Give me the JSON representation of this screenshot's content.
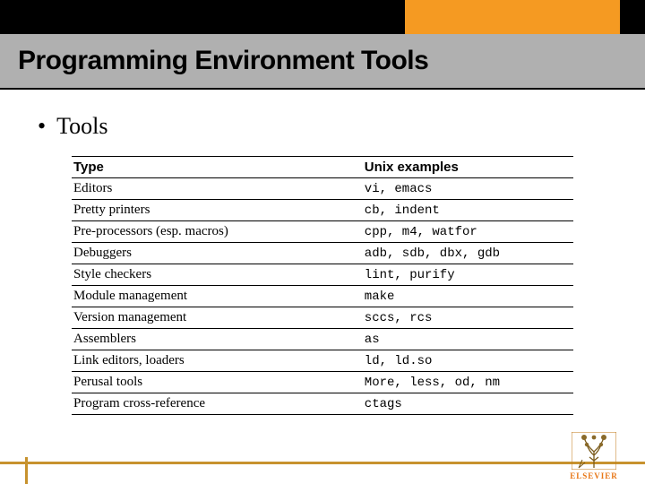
{
  "slide": {
    "title": "Programming Environment Tools",
    "bullet": "Tools"
  },
  "table": {
    "headers": {
      "col1": "Type",
      "col2": "Unix examples"
    },
    "rows": [
      {
        "type": "Editors",
        "example": "vi, emacs"
      },
      {
        "type": "Pretty printers",
        "example": "cb, indent"
      },
      {
        "type": "Pre-processors (esp. macros)",
        "example": "cpp, m4, watfor"
      },
      {
        "type": "Debuggers",
        "example": "adb, sdb, dbx, gdb"
      },
      {
        "type": "Style checkers",
        "example": "lint, purify"
      },
      {
        "type": "Module management",
        "example": "make"
      },
      {
        "type": "Version management",
        "example": "sccs, rcs"
      },
      {
        "type": "Assemblers",
        "example": "as"
      },
      {
        "type": "Link editors, loaders",
        "example": "ld, ld.so"
      },
      {
        "type": "Perusal tools",
        "example": "More, less, od, nm"
      },
      {
        "type": "Program cross-reference",
        "example": "ctags"
      }
    ]
  },
  "logo": {
    "text": "ELSEVIER"
  }
}
